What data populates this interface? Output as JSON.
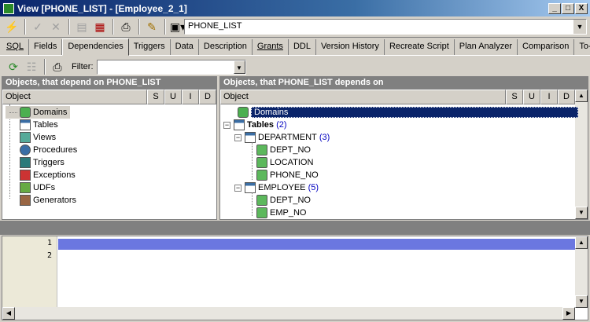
{
  "window": {
    "title": "View [PHONE_LIST] - [Employee_2_1]",
    "buttons": {
      "minimize": "_",
      "maximize": "□",
      "close": "X"
    }
  },
  "toolbar": {
    "object_name": "PHONE_LIST",
    "icons": [
      "lightning-icon",
      "check-icon",
      "cancel-icon",
      "table-icon",
      "print-preview-icon",
      "print-icon",
      "tools-icon",
      "menu-icon"
    ]
  },
  "tabs": [
    {
      "label": "SQL"
    },
    {
      "label": "Fields"
    },
    {
      "label": "Dependencies"
    },
    {
      "label": "Triggers"
    },
    {
      "label": "Data"
    },
    {
      "label": "Description"
    },
    {
      "label": "Grants"
    },
    {
      "label": "DDL"
    },
    {
      "label": "Version History"
    },
    {
      "label": "Recreate Script"
    },
    {
      "label": "Plan Analyzer"
    },
    {
      "label": "Comparison"
    },
    {
      "label": "To-do"
    }
  ],
  "active_tab": "Dependencies",
  "filter": {
    "label": "Filter:",
    "value": ""
  },
  "left_panel": {
    "title": "Objects, that depend on PHONE_LIST",
    "columns": [
      "Object",
      "S",
      "U",
      "I",
      "D"
    ],
    "items": [
      {
        "label": "Domains",
        "icon": "domain-icon"
      },
      {
        "label": "Tables",
        "icon": "table-icon"
      },
      {
        "label": "Views",
        "icon": "view-icon"
      },
      {
        "label": "Procedures",
        "icon": "procedure-icon"
      },
      {
        "label": "Triggers",
        "icon": "trigger-icon"
      },
      {
        "label": "Exceptions",
        "icon": "exception-icon"
      },
      {
        "label": "UDFs",
        "icon": "udf-icon"
      },
      {
        "label": "Generators",
        "icon": "generator-icon"
      }
    ]
  },
  "right_panel": {
    "title": "Objects, that PHONE_LIST depends on",
    "columns": [
      "Object",
      "S",
      "U",
      "I",
      "D"
    ],
    "domains": "Domains",
    "tables": {
      "label": "Tables",
      "count": "(2)"
    },
    "department": {
      "label": "DEPARTMENT",
      "count": "(3)",
      "fields": [
        "DEPT_NO",
        "LOCATION",
        "PHONE_NO"
      ]
    },
    "employee": {
      "label": "EMPLOYEE",
      "count": "(5)",
      "fields": [
        "DEPT_NO",
        "EMP_NO"
      ]
    }
  },
  "editor": {
    "line_numbers": [
      "1",
      "2"
    ],
    "lines": [
      "",
      ""
    ]
  },
  "colors": {
    "title_bar": "#0a246a",
    "selection": "#0a246a",
    "current_line": "#6b77e0",
    "count_text": "#0000c0"
  }
}
